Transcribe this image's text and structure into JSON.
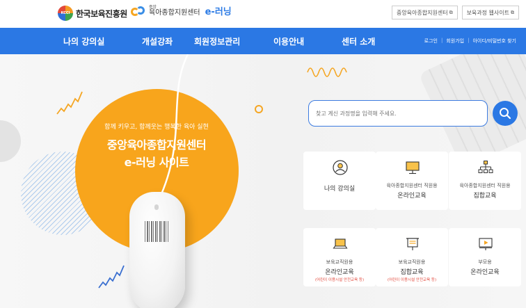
{
  "header": {
    "kcci_mark": "KCCI",
    "kcci_name": "한국보육진흥원",
    "center_small": "중앙",
    "center_name": "육아종합지원센터",
    "elearning": "e-러닝",
    "ext_links": [
      {
        "label": "중앙육아종합지원센터",
        "icon": "external-link-icon"
      },
      {
        "label": "보육과정 웹사이트",
        "icon": "external-link-icon"
      }
    ]
  },
  "nav": {
    "items": [
      "나의 강의실",
      "개설강좌",
      "회원정보관리",
      "이용안내",
      "센터 소개"
    ],
    "utils": [
      "로그인",
      "회원가입",
      "아이디/비밀번호 찾기"
    ]
  },
  "hero": {
    "subtitle": "함께 키우고, 함께웃는 행복한 육아 실현",
    "title1": "중앙육아종합지원센터",
    "title2": "e-러닝 사이트"
  },
  "search": {
    "placeholder": "찾고 계신 과정명을 입력해 주세요."
  },
  "cards": [
    {
      "icon": "user-circle-icon",
      "line1": "나의 강의실",
      "line2": "",
      "line3": ""
    },
    {
      "icon": "monitor-icon",
      "line1": "육아종합지원센터 직원용",
      "line2": "온라인교육",
      "line3": ""
    },
    {
      "icon": "org-chart-icon",
      "line1": "육아종합지원센터 직원용",
      "line2": "집합교육",
      "line3": ""
    },
    {
      "icon": "laptop-icon",
      "line1": "보육교직원용",
      "line2": "온라인교육",
      "line3": "(어린이 이용시설 안전교육 등)"
    },
    {
      "icon": "presentation-board-icon",
      "line1": "보육교직원용",
      "line2": "집합교육",
      "line3": "(어린이 이용시설 안전교육 등)"
    },
    {
      "icon": "video-monitor-icon",
      "line1": "부모용",
      "line2": "온라인교육",
      "line3": ""
    }
  ],
  "colors": {
    "nav_blue": "#2b78e4",
    "hero_orange": "#f8a51c",
    "accent_red": "#e2483b"
  }
}
